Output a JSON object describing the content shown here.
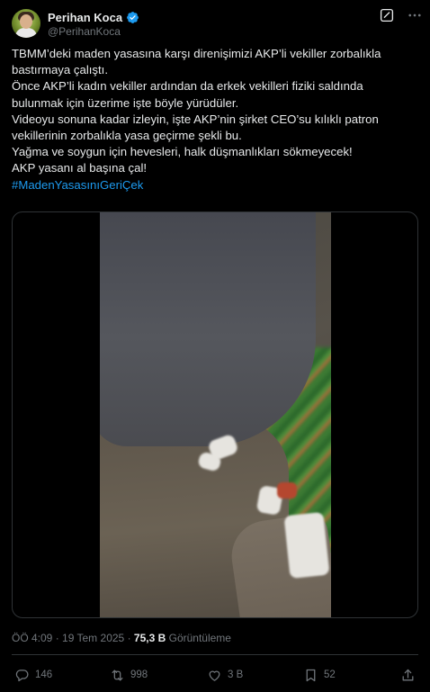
{
  "author": {
    "name": "Perihan Koca",
    "handle": "@PerihanKoca",
    "verified_color": "#1d9bf0"
  },
  "icons": {
    "verified": "verified-badge-icon",
    "grok": "grok-icon",
    "more": "more-options-icon",
    "reply": "reply-icon",
    "retweet": "retweet-icon",
    "like": "like-icon",
    "bookmark": "bookmark-icon",
    "share": "share-icon"
  },
  "tweet": {
    "lines": [
      "TBMM’deki maden yasasına karşı direnişimizi AKP’li vekiller zorbalıkla",
      "bastırmaya çalıştı.",
      "Önce AKP’li kadın vekiller ardından da erkek vekilleri fiziki saldında",
      "bulunmak için üzerime işte böyle yürüdüler.",
      "Videoyu sonuna kadar izleyin, işte AKP’nin şirket CEO’su kılıklı patron",
      "vekillerinin zorbalıkla yasa geçirme şekli bu.",
      "Yağma ve soygun için hevesleri, halk düşmanlıkları sökmeyecek!",
      "AKP yasanı al başına çal!"
    ],
    "hashtag": "#MadenYasasınıGeriÇek",
    "hashtag_color": "#1d9bf0"
  },
  "meta": {
    "time": "ÖÖ 4:09",
    "separator": "·",
    "date": "19 Tem 2025",
    "views_count": "75,3 B",
    "views_label": "Görüntüleme"
  },
  "actions": {
    "replies": "146",
    "retweets": "998",
    "likes": "3 B",
    "bookmarks": "52"
  }
}
